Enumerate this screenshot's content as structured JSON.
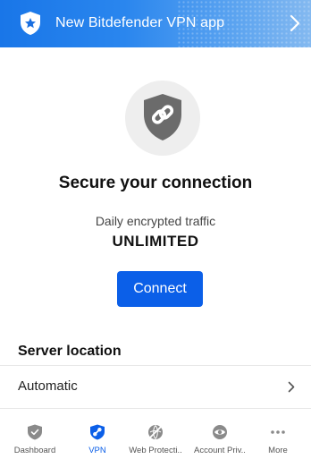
{
  "banner": {
    "title": "New Bitdefender VPN app"
  },
  "hero": {
    "heading": "Secure your connection"
  },
  "traffic": {
    "label": "Daily encrypted traffic",
    "value": "UNLIMITED"
  },
  "connect_label": "Connect",
  "server": {
    "title": "Server location",
    "selected": "Automatic"
  },
  "tabs": [
    {
      "label": "Dashboard",
      "icon": "shield-check-icon",
      "active": false
    },
    {
      "label": "VPN",
      "icon": "vpn-shield-icon",
      "active": true
    },
    {
      "label": "Web Protecti..",
      "icon": "globe-slash-icon",
      "active": false
    },
    {
      "label": "Account Priv..",
      "icon": "eye-icon",
      "active": false
    },
    {
      "label": "More",
      "icon": "more-dots-icon",
      "active": false
    }
  ],
  "colors": {
    "accent": "#0b5fe8",
    "banner": "#1976e8",
    "inactive_icon": "#8a8a8a"
  }
}
